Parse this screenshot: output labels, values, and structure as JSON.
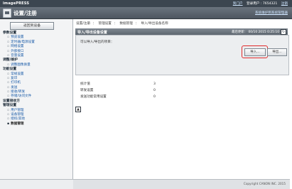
{
  "app": {
    "brand": "imagePRESS",
    "title": "设置/注册",
    "topnav": [
      "到门户",
      "登录用户 : 7654321",
      "注销"
    ],
    "device_link": "系统维护到系统管理器"
  },
  "sidebar": {
    "home_button": "返回到设备",
    "sections": [
      {
        "title": "参数设置",
        "items": [
          "预览设置",
          "定时器/电源设置",
          "网络设置",
          "外部接口",
          "音量设置"
        ]
      },
      {
        "title": "调整/维护",
        "items": [
          "调整图像质量"
        ]
      },
      {
        "title": "功能设置",
        "items": [
          "常规设置",
          "复印",
          "打印机",
          "发送",
          "接收/转发",
          "存储/访问文件"
        ]
      },
      {
        "title": "设置接收方",
        "items": []
      },
      {
        "title": "管理设置",
        "items": [
          "用户管理",
          "设备管理",
          "授权/其他",
          "数据管理"
        ]
      }
    ],
    "active_item": "数据管理"
  },
  "breadcrumb": [
    "设置/注册",
    "：",
    "管理设置",
    "：",
    "数据管理",
    "：",
    "导入/导出设备名称"
  ],
  "panel": {
    "title": "导入/导出设备设置",
    "time_label": "最后更新：",
    "time_value": "00/10 2015 0:25:10",
    "refresh_icon": "↻",
    "description": "可以导入/导出的项目：",
    "import_button": "导入...",
    "export_button": "导出..."
  },
  "stats": [
    {
      "label": "统计值",
      "value": "3"
    },
    {
      "label": "转发设置",
      "value": "0"
    },
    {
      "label": "发送功能常用设置",
      "value": "0"
    }
  ],
  "back_icon": "▲",
  "footer": {
    "copyright": "Copyright CANON INC. 2015"
  },
  "colors": {
    "highlight": "#e12a2a",
    "topbar": "#3c4650",
    "link": "#1a5ba8"
  }
}
